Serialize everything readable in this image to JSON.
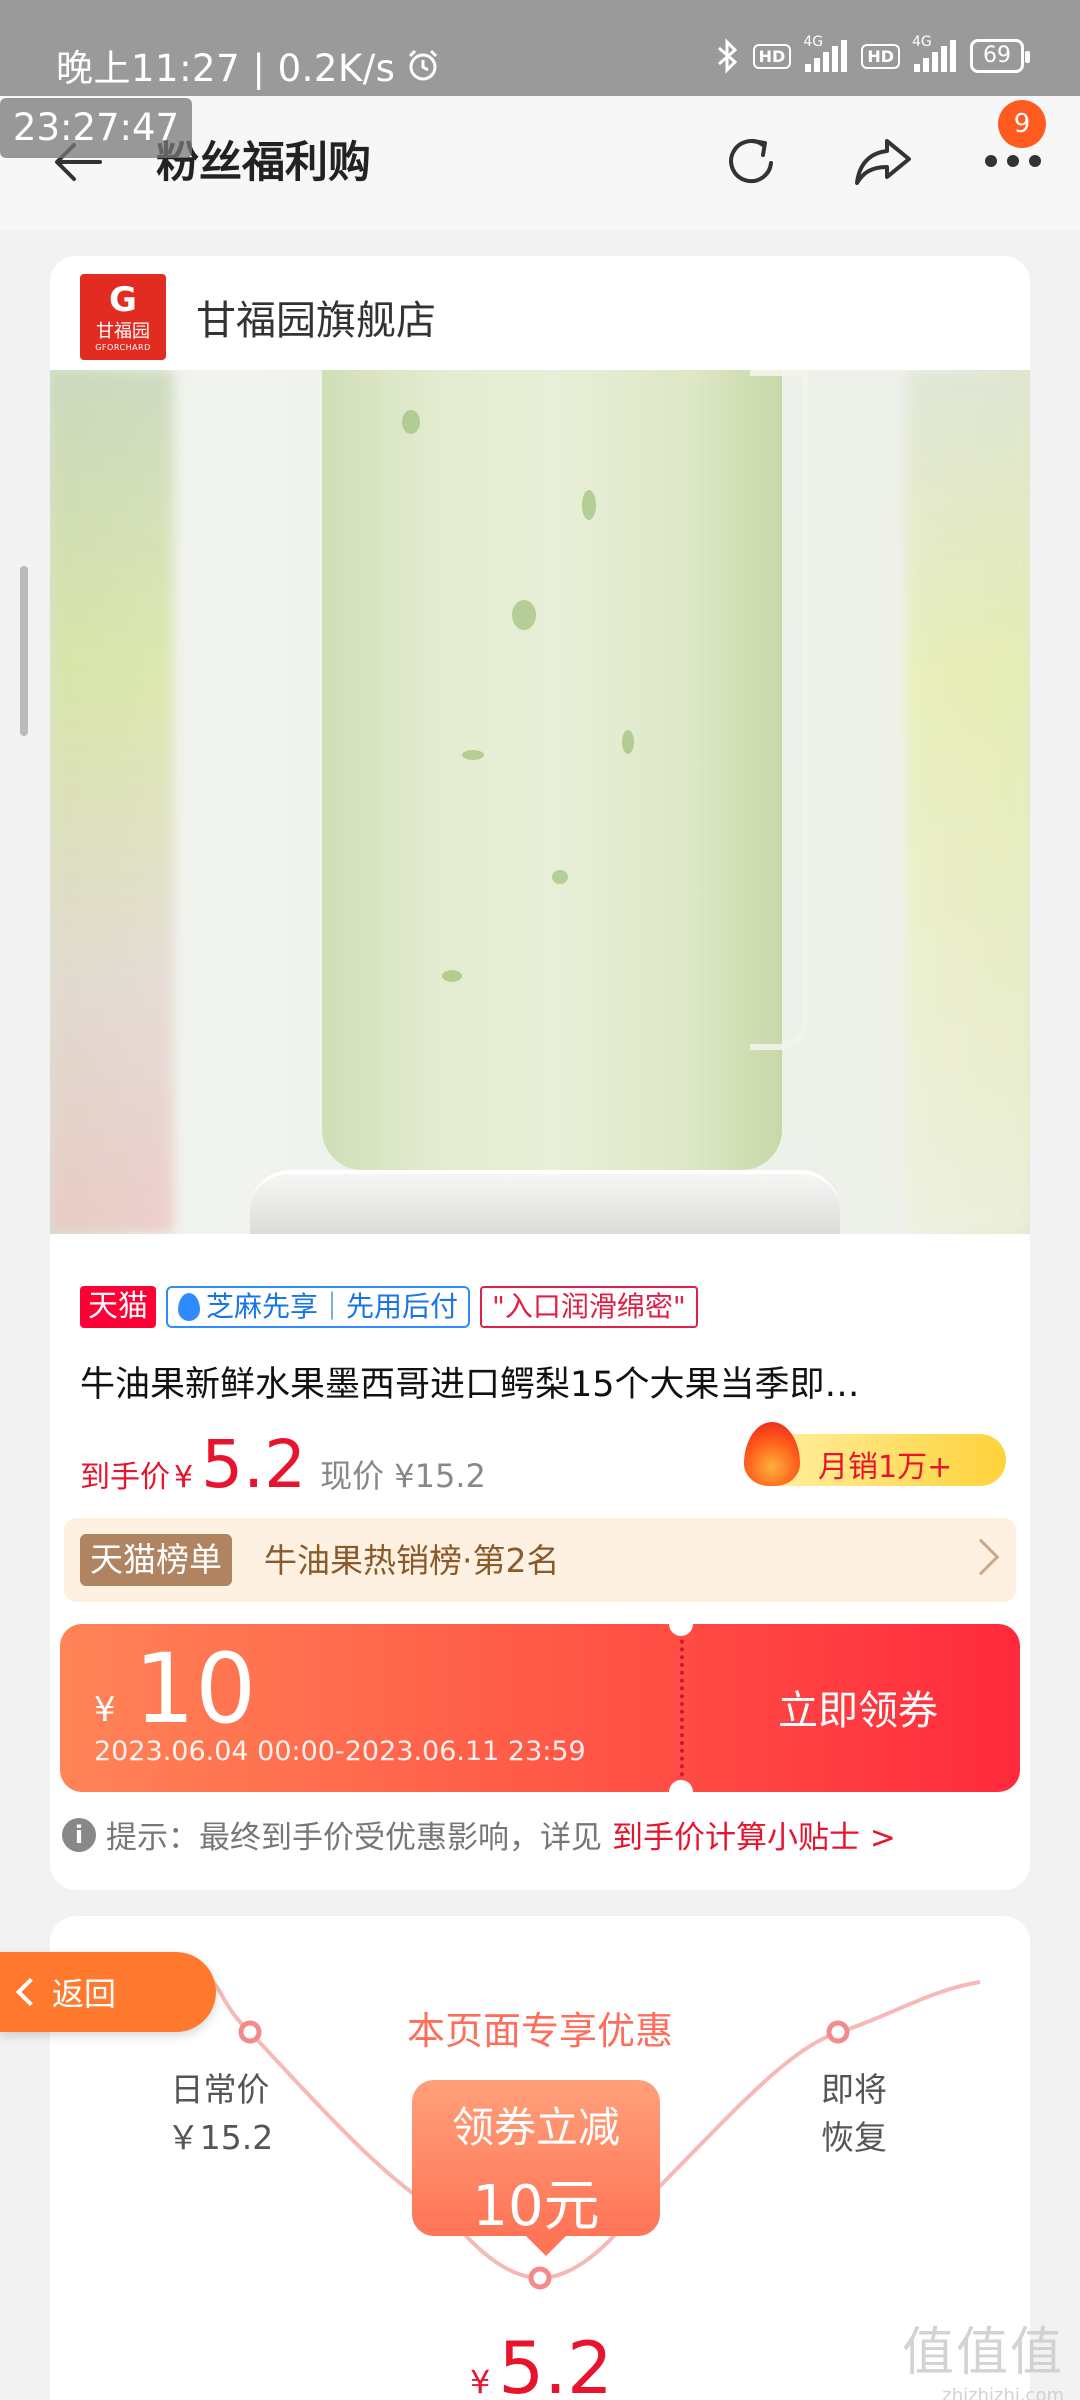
{
  "status_bar": {
    "time": "晚上11:27 | 0.2K/s",
    "alarm_icon": "alarm-clock-icon",
    "bluetooth_icon": "bluetooth-icon",
    "hd1": "HD",
    "net1": "4G",
    "hd2": "HD",
    "net2": "4G",
    "battery": "69"
  },
  "clock_overlay": "23:27:47",
  "header": {
    "title": "粉丝福利购",
    "more_badge": "9",
    "back_icon": "back-arrow-icon",
    "refresh_icon": "refresh-icon",
    "share_icon": "share-icon",
    "more_icon": "more-dots-icon"
  },
  "shop": {
    "logo_text": "甘福园",
    "logo_sub": "GFORCHARD",
    "name": "甘福园旗舰店"
  },
  "tags": {
    "tmall": "天猫",
    "zhima": "芝麻先享｜先用后付",
    "quote": "\"入口润滑绵密\""
  },
  "product": {
    "title": "牛油果新鲜水果墨西哥进口鳄梨15个大果当季即…",
    "price_label": "到手价",
    "price_yen": "¥",
    "price_value": "5.2",
    "price_now": "现价 ¥15.2",
    "sales": "月销1万+"
  },
  "rank": {
    "badge": "天猫榜单",
    "text": "牛油果热销榜·第2名"
  },
  "coupon": {
    "yen": "¥",
    "amount": "10",
    "validity": "2023.06.04 00:00-2023.06.11 23:59",
    "claim": "立即领券"
  },
  "tip": {
    "prefix": "提示：最终到手价受优惠影响，详见",
    "link": "到手价计算小贴士 >"
  },
  "promo": {
    "heading": "本页面专享优惠",
    "daily_label": "日常价",
    "daily_price": "￥15.2",
    "restore_line1": "即将",
    "restore_line2": "恢复",
    "box_line1": "领券立减",
    "box_line2": "10元",
    "final_yen": "¥",
    "final_value": "5.2"
  },
  "return_button": "返回",
  "watermark": {
    "line1": "值值值",
    "line2": "zhizhizhi.com"
  },
  "colors": {
    "accent_red": "#e8142d",
    "coupon_orange": "#ff5a47",
    "return_orange": "#ff7a2e",
    "tmall_red": "#ff0036",
    "zhima_blue": "#2f8bff"
  }
}
